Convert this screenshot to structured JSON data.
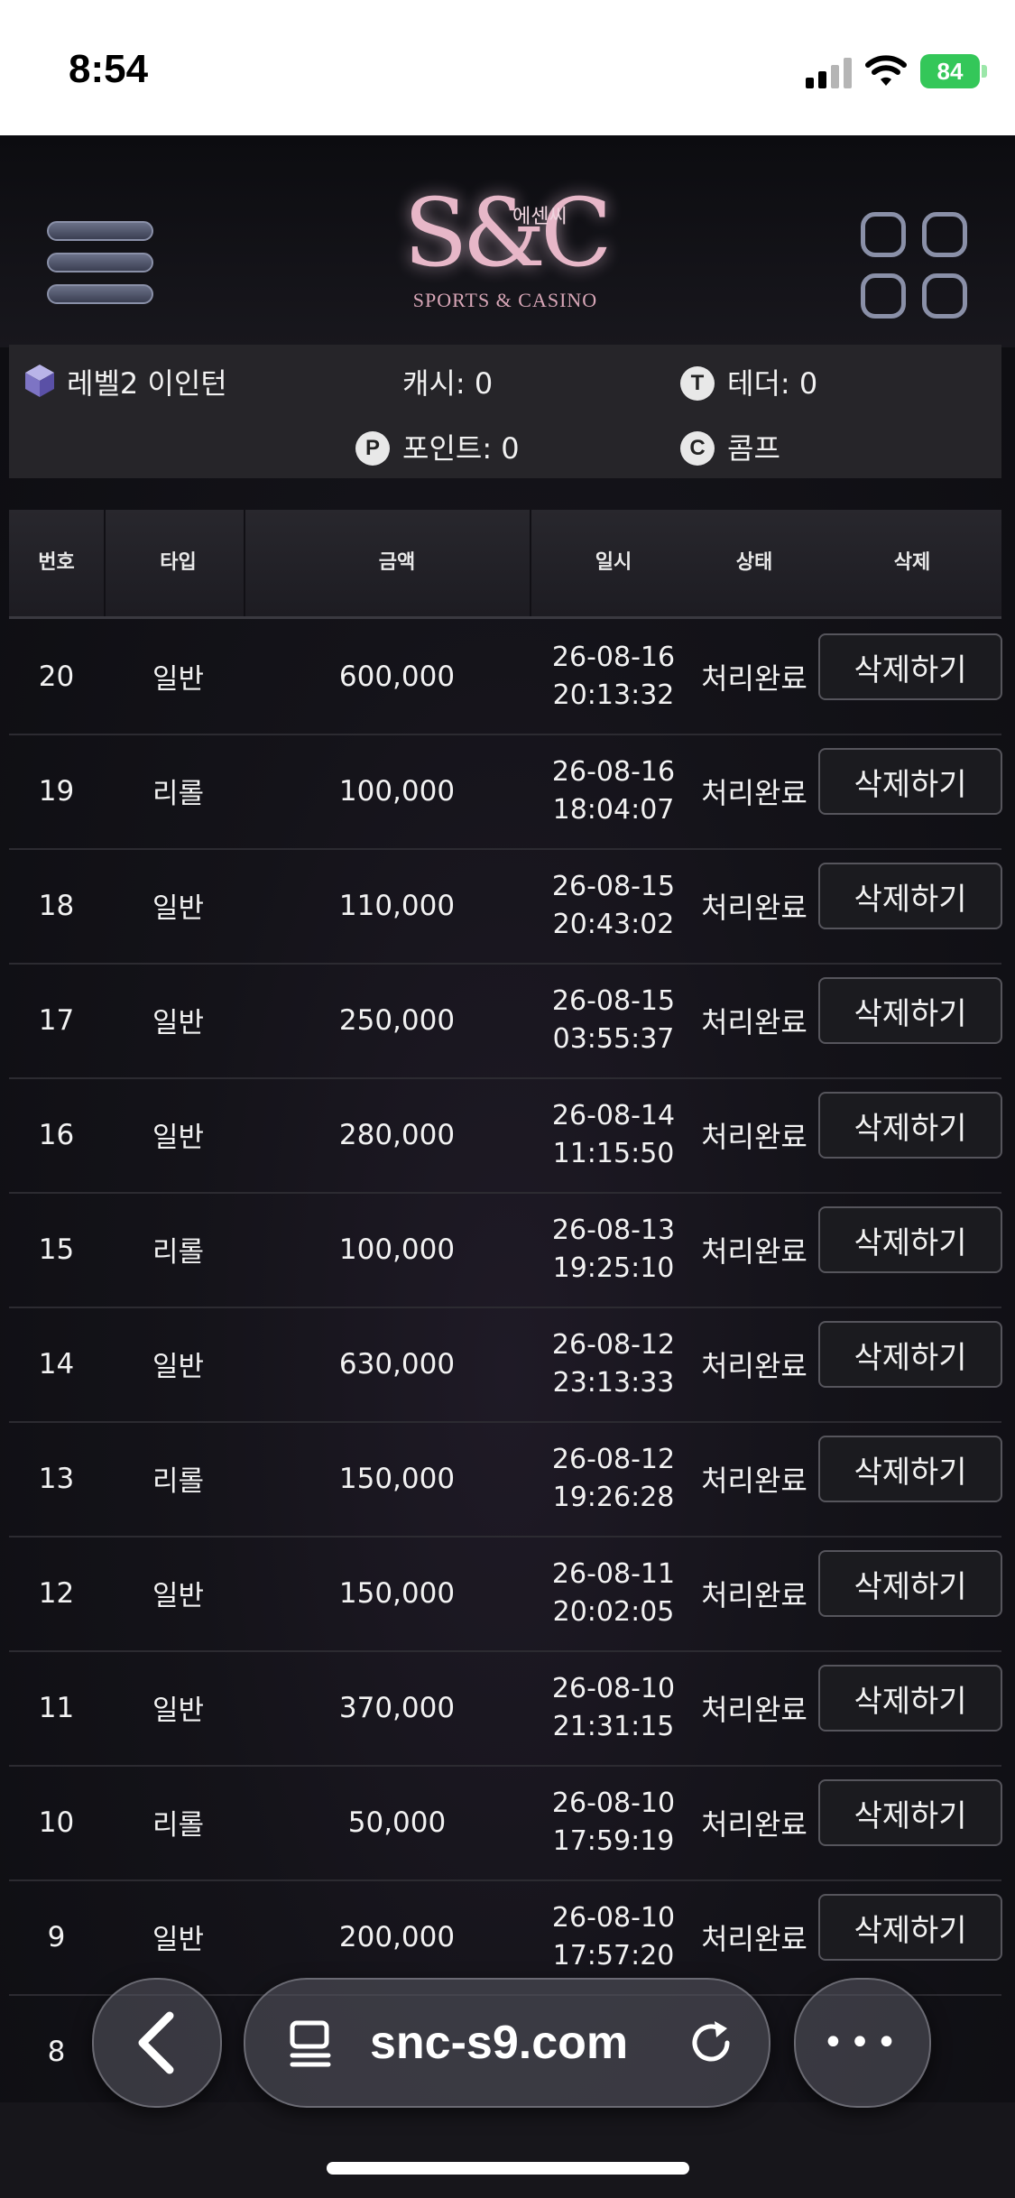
{
  "status_bar": {
    "time": "8:54",
    "battery": "84"
  },
  "header": {
    "logo_mark": "S&C",
    "logo_korean": "에센씨",
    "logo_sub": "SPORTS & CASINO"
  },
  "account": {
    "level": "레벨2 이인턴",
    "cash": "캐시: 0",
    "tether": "테더: 0",
    "points": "포인트: 0",
    "comp": "콤프"
  },
  "table": {
    "headers": {
      "no": "번호",
      "type": "타입",
      "amount": "금액",
      "datetime": "일시",
      "status": "상태",
      "delete": "삭제"
    },
    "rows": [
      {
        "no": "20",
        "type": "일반",
        "amount": "600,000",
        "date": "26-08-16",
        "time": "20:13:32",
        "status": "처리완료",
        "action": "삭제하기"
      },
      {
        "no": "19",
        "type": "리롤",
        "amount": "100,000",
        "date": "26-08-16",
        "time": "18:04:07",
        "status": "처리완료",
        "action": "삭제하기"
      },
      {
        "no": "18",
        "type": "일반",
        "amount": "110,000",
        "date": "26-08-15",
        "time": "20:43:02",
        "status": "처리완료",
        "action": "삭제하기"
      },
      {
        "no": "17",
        "type": "일반",
        "amount": "250,000",
        "date": "26-08-15",
        "time": "03:55:37",
        "status": "처리완료",
        "action": "삭제하기"
      },
      {
        "no": "16",
        "type": "일반",
        "amount": "280,000",
        "date": "26-08-14",
        "time": "11:15:50",
        "status": "처리완료",
        "action": "삭제하기"
      },
      {
        "no": "15",
        "type": "리롤",
        "amount": "100,000",
        "date": "26-08-13",
        "time": "19:25:10",
        "status": "처리완료",
        "action": "삭제하기"
      },
      {
        "no": "14",
        "type": "일반",
        "amount": "630,000",
        "date": "26-08-12",
        "time": "23:13:33",
        "status": "처리완료",
        "action": "삭제하기"
      },
      {
        "no": "13",
        "type": "리롤",
        "amount": "150,000",
        "date": "26-08-12",
        "time": "19:26:28",
        "status": "처리완료",
        "action": "삭제하기"
      },
      {
        "no": "12",
        "type": "일반",
        "amount": "150,000",
        "date": "26-08-11",
        "time": "20:02:05",
        "status": "처리완료",
        "action": "삭제하기"
      },
      {
        "no": "11",
        "type": "일반",
        "amount": "370,000",
        "date": "26-08-10",
        "time": "21:31:15",
        "status": "처리완료",
        "action": "삭제하기"
      },
      {
        "no": "10",
        "type": "리롤",
        "amount": "50,000",
        "date": "26-08-10",
        "time": "17:59:19",
        "status": "처리완료",
        "action": "삭제하기"
      },
      {
        "no": "9",
        "type": "일반",
        "amount": "200,000",
        "date": "26-08-10",
        "time": "17:57:20",
        "status": "처리완료",
        "action": "삭제하기"
      },
      {
        "no": "8",
        "type": "",
        "amount": "",
        "date": "",
        "time": "",
        "status": "",
        "action": ""
      }
    ]
  },
  "browser": {
    "url": "snc-s9.com",
    "more": "•••"
  },
  "colors": {
    "background": "#0f0f13",
    "panel": "#262529",
    "battery": "#34c759",
    "logo": "#e7b7c8"
  }
}
